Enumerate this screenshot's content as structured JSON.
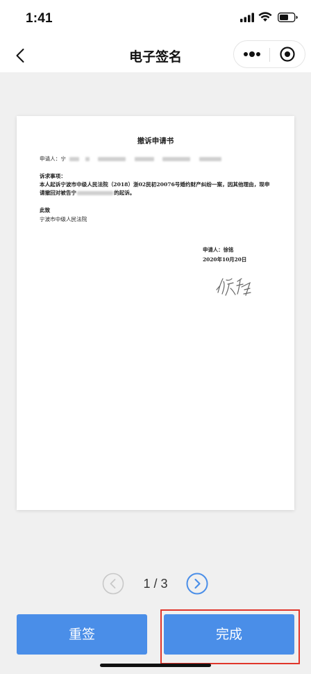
{
  "status_bar": {
    "time": "1:41",
    "icons": [
      "signal-icon",
      "wifi-icon",
      "battery-icon"
    ]
  },
  "nav": {
    "title": "电子签名",
    "back_icon": "chevron-left-icon",
    "capsule_icons": [
      "more-icon",
      "close-target-icon"
    ]
  },
  "document": {
    "title": "撤诉申请书",
    "applicant_label": "申请人：宁",
    "request_heading": "诉求事项：",
    "body_line1": "本人起诉宁波市中级人民法院（2018）浙02民初20076号婚约财产纠纷一案，因其他理由，现申",
    "body_line2_start": "请撤回对被告宁",
    "body_line2_end": "的起诉。",
    "closing": "此致",
    "court": "宁波市中级人民法院",
    "signer": "申请人：徐铭",
    "date": "2020年10月20日",
    "signature_text": "徐铭"
  },
  "pager": {
    "text": "1 / 3",
    "current_page": 1,
    "total_pages": 3,
    "prev_icon": "chevron-left-circle-icon",
    "next_icon": "chevron-right-circle-icon"
  },
  "actions": {
    "resign_label": "重签",
    "done_label": "完成"
  },
  "colors": {
    "accent": "#4a8ee8",
    "highlight": "#e0352b",
    "page_background": "#f0f0f0"
  }
}
